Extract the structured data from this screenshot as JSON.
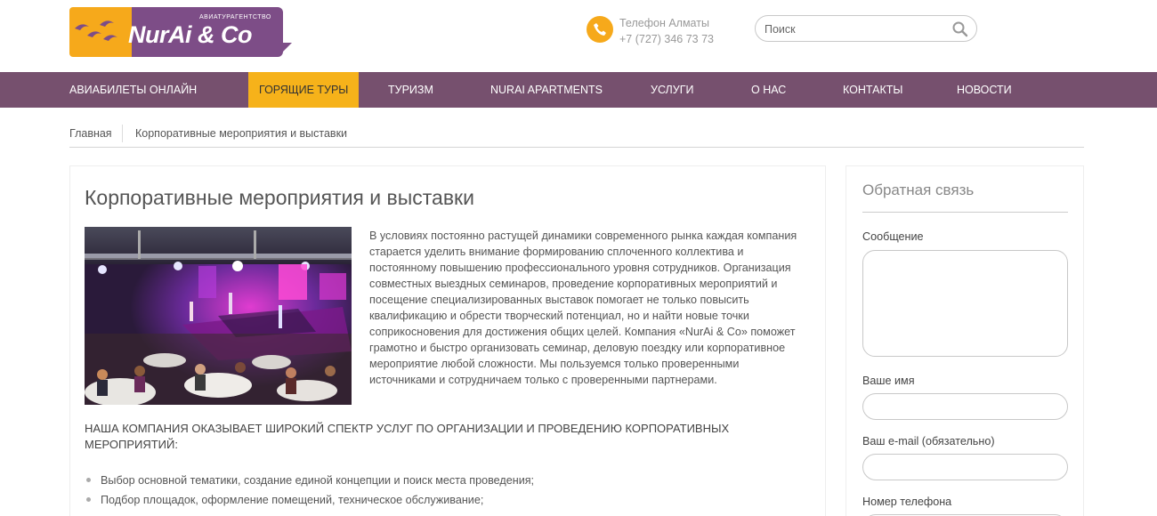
{
  "header": {
    "logo_tagline": "АВИАТУРАГЕНТСТВО",
    "logo_text": "NurAi & Co",
    "phone_label": "Телефон Алматы",
    "phone_number": "+7 (727) 346 73 73",
    "search_placeholder": "Поиск"
  },
  "nav": {
    "items": [
      {
        "label": "АВИАБИЛЕТЫ ОНЛАЙН"
      },
      {
        "label": "ГОРЯЩИЕ ТУРЫ",
        "active": true
      },
      {
        "label": "ТУРИЗМ"
      },
      {
        "label": "NURAI APARTMENTS"
      },
      {
        "label": "УСЛУГИ"
      },
      {
        "label": "О НАС"
      },
      {
        "label": "КОНТАКТЫ"
      },
      {
        "label": "НОВОСТИ"
      }
    ]
  },
  "breadcrumb": {
    "home": "Главная",
    "current": "Корпоративные мероприятия и выставки"
  },
  "main": {
    "title": "Корпоративные мероприятия и выставки",
    "intro": "В условиях постоянно растущей динамики современного рынка каждая компания старается уделить внимание формированию сплоченного коллектива и постоянному повышению профессионального уровня сотрудников. Организация совместных выездных семинаров, проведение корпоративных мероприятий и посещение специализированных выставок помогает не только повысить квалификацию и обрести творческий потенциал, но и найти новые точки соприкосновения для достижения общих целей. Компания «NurAi & Co» поможет грамотно и быстро организовать семинар, деловую поездку или корпоративное мероприятие любой сложности. Мы пользуемся только проверенными источниками и сотрудничаем только с проверенными партнерами.",
    "services_heading": "НАША КОМПАНИЯ ОКАЗЫВАЕТ ШИРОКИЙ СПЕКТР УСЛУГ ПО ОРГАНИЗАЦИИ И ПРОВЕДЕНИЮ КОРПОРАТИВНЫХ МЕРОПРИЯТИЙ:",
    "services": [
      "Выбор основной тематики, создание единой концепции и поиск места проведения;",
      "Подбор площадок, оформление помещений, техническое обслуживание;"
    ]
  },
  "sidebar": {
    "title": "Обратная связь",
    "message_label": "Сообщение",
    "name_label": "Ваше имя",
    "email_label": "Ваш e-mail (обязательно)",
    "phone_label": "Номер телефона"
  },
  "colors": {
    "brand_purple": "#76506e",
    "brand_orange": "#f6b21a"
  }
}
